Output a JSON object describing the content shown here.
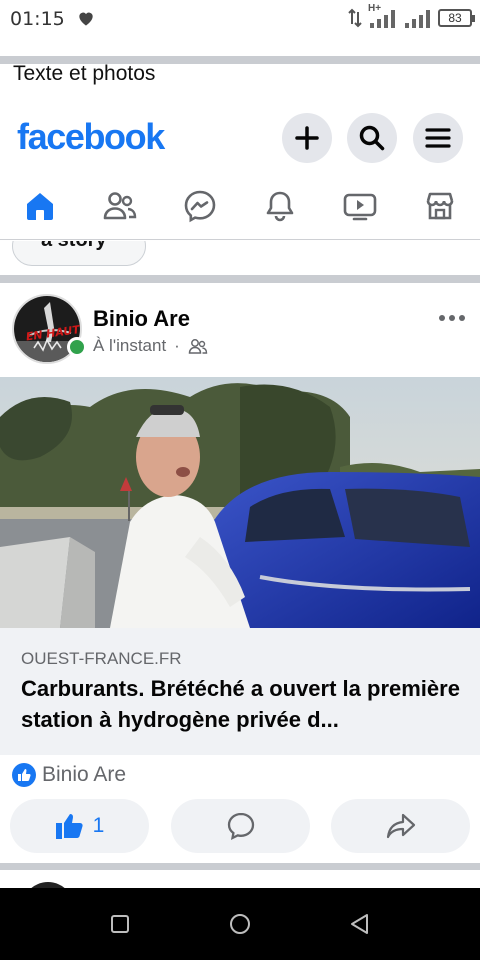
{
  "status_bar": {
    "time": "01:15",
    "network": "H+",
    "battery": "83"
  },
  "prompt": {
    "text": "Texte et photos"
  },
  "header": {
    "logo": "facebook",
    "brand_color": "#1877f2",
    "buttons": [
      {
        "name": "create-button",
        "icon": "plus-icon"
      },
      {
        "name": "search-button",
        "icon": "search-icon"
      },
      {
        "name": "menu-button",
        "icon": "hamburger-icon"
      }
    ]
  },
  "tabs": [
    {
      "name": "home",
      "icon": "home-icon",
      "active": true
    },
    {
      "name": "friends",
      "icon": "friends-icon",
      "active": false
    },
    {
      "name": "messenger",
      "icon": "messenger-icon",
      "active": false
    },
    {
      "name": "notifications",
      "icon": "bell-icon",
      "active": false
    },
    {
      "name": "video",
      "icon": "video-icon",
      "active": false
    },
    {
      "name": "marketplace",
      "icon": "marketplace-icon",
      "active": false
    }
  ],
  "story": {
    "label": "a story"
  },
  "post": {
    "author": "Binio Are",
    "avatar_text": "EN HAUT",
    "timestamp": "À l'instant",
    "separator": "·",
    "audience_icon": "friends-icon",
    "link": {
      "domain": "OUEST-FRANCE.FR",
      "title": "Carburants. Brétéché a ouvert la première station à hydrogène privée d..."
    },
    "reaction_names": "Binio Are",
    "like_count": "1",
    "actions": [
      {
        "name": "like",
        "icon": "thumbs-up-icon"
      },
      {
        "name": "comment",
        "icon": "comment-icon"
      },
      {
        "name": "share",
        "icon": "share-icon"
      }
    ]
  },
  "colors": {
    "accent": "#1877f2",
    "online": "#31a24c",
    "secondary_text": "#65676b",
    "button_bg": "#e4e6eb",
    "divider": "#c9ccd1"
  }
}
